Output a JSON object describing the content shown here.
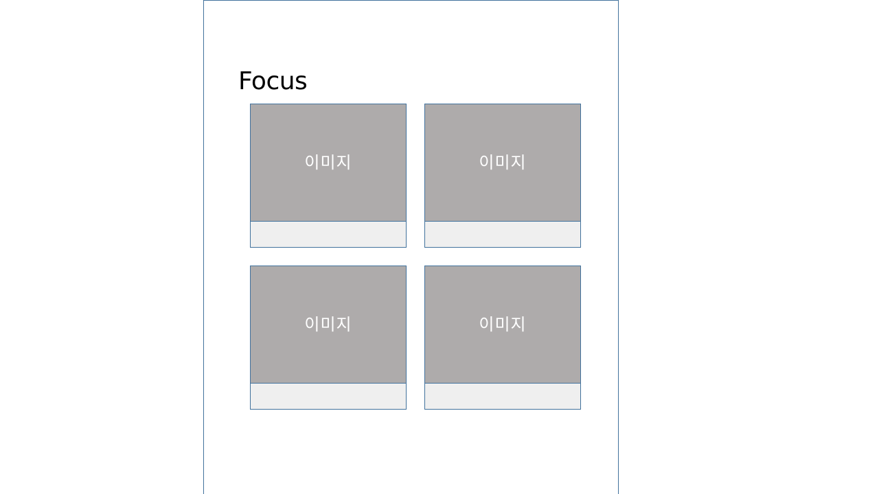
{
  "section": {
    "title": "Focus"
  },
  "cards": [
    {
      "image_label": "이미지",
      "caption": ""
    },
    {
      "image_label": "이미지",
      "caption": ""
    },
    {
      "image_label": "이미지",
      "caption": ""
    },
    {
      "image_label": "이미지",
      "caption": ""
    }
  ],
  "colors": {
    "border": "#41719c",
    "image_placeholder": "#aeabab",
    "caption_background": "#efefef"
  }
}
